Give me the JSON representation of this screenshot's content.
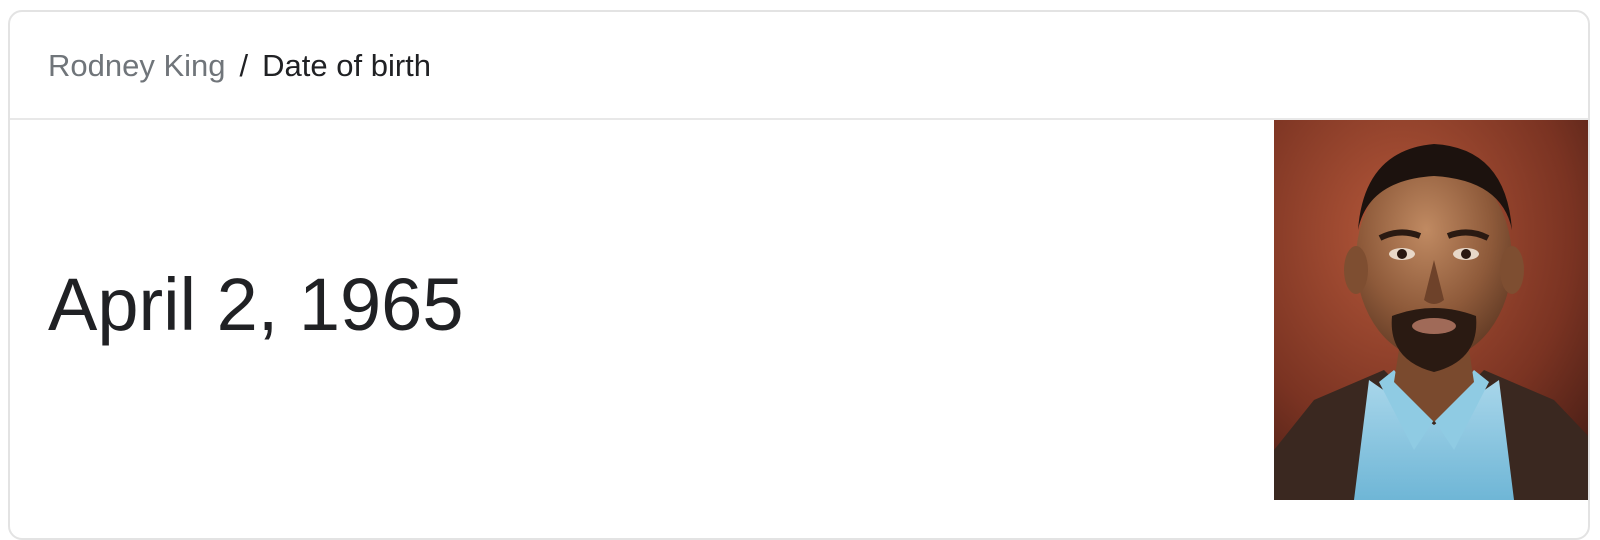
{
  "breadcrumb": {
    "parent": "Rodney King",
    "separator": "/",
    "current": "Date of birth"
  },
  "answer": {
    "value": "April 2, 1965"
  },
  "photo": {
    "subject": "portrait-photo"
  },
  "colors": {
    "text_primary": "#202124",
    "text_secondary": "#70757a",
    "border": "#e3e3e3"
  }
}
